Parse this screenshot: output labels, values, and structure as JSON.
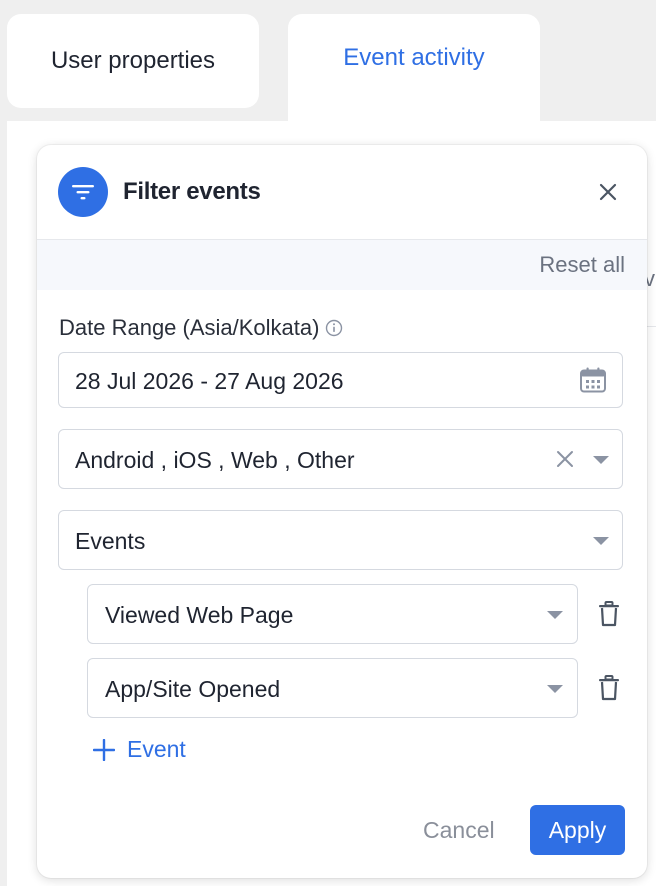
{
  "tabs": [
    {
      "label": "User properties",
      "active": false
    },
    {
      "label": "Event activity",
      "active": true
    }
  ],
  "background_peek": {
    "text": "v"
  },
  "filter_panel": {
    "title": "Filter events",
    "icon": "filter-icon",
    "close_icon": "close-icon",
    "reset_all": "Reset all",
    "date_range": {
      "label": "Date Range (Asia/Kolkata)",
      "info_icon": "info-icon",
      "value": "28 Jul 2026 - 27 Aug 2026",
      "calendar_icon": "calendar-icon"
    },
    "platforms": {
      "value": "Android , iOS , Web , Other"
    },
    "events_select": {
      "value": "Events"
    },
    "event_rows": [
      {
        "value": "Viewed Web Page"
      },
      {
        "value": "App/Site Opened"
      }
    ],
    "add_event_label": "Event",
    "cancel_label": "Cancel",
    "apply_label": "Apply"
  },
  "colors": {
    "accent": "#2f6fe4",
    "background": "#efefef",
    "muted_text": "#6b7280",
    "border": "#d5d9e0"
  }
}
